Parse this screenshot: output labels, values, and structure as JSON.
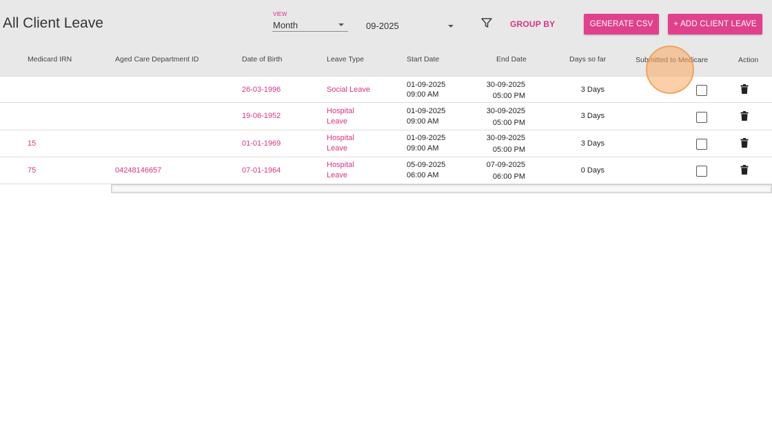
{
  "header": {
    "title": "All Client Leave",
    "view": {
      "caption": "VIEW",
      "value": "Month"
    },
    "period": {
      "value": "09-2025"
    },
    "group_by_label": "GROUP BY",
    "generate_csv_label": "GENERATE CSV",
    "add_leave_label": "+ ADD CLIENT LEAVE"
  },
  "table": {
    "columns": {
      "medicard_irn": "Medicard IRN",
      "aged_care_id": "Aged Care Department ID",
      "dob": "Date of Birth",
      "leave_type": "Leave Type",
      "start_date": "Start Date",
      "end_date": "End Date",
      "days_so_far": "Days so far",
      "submitted": "Submitted to Medicare",
      "action": "Action"
    },
    "rows": [
      {
        "irn": "",
        "aged_care_id": "",
        "dob": "26-03-1996",
        "leave_type_1": "Social Leave",
        "leave_type_2": "",
        "start_date": "01-09-2025",
        "start_time": "09:00 AM",
        "end_date": "30-09-2025",
        "end_time": "05:00 PM",
        "days": "3 Days",
        "submitted": false
      },
      {
        "irn": "",
        "aged_care_id": "",
        "dob": "19-06-1952",
        "leave_type_1": "Hospital",
        "leave_type_2": "Leave",
        "start_date": "01-09-2025",
        "start_time": "09:00 AM",
        "end_date": "30-09-2025",
        "end_time": "05:00 PM",
        "days": "3 Days",
        "submitted": false
      },
      {
        "irn": "15",
        "aged_care_id": "",
        "dob": "01-01-1969",
        "leave_type_1": "Hospital",
        "leave_type_2": "Leave",
        "start_date": "01-09-2025",
        "start_time": "09:00 AM",
        "end_date": "30-09-2025",
        "end_time": "05:00 PM",
        "days": "3 Days",
        "submitted": false
      },
      {
        "irn": "75",
        "aged_care_id": "04248146657",
        "dob": "07-01-1964",
        "leave_type_1": "Hospital",
        "leave_type_2": "Leave",
        "start_date": "05-09-2025",
        "start_time": "06:00 AM",
        "end_date": "07-09-2025",
        "end_time": "06:00 PM",
        "days": "0 Days",
        "submitted": false
      }
    ]
  },
  "icons": {
    "filter": "filter-icon",
    "delete": "trash-icon",
    "dropdown": "caret-down-icon"
  },
  "colors": {
    "accent": "#e0418c",
    "link": "#d63384",
    "header_bg": "#e8e8e8"
  }
}
